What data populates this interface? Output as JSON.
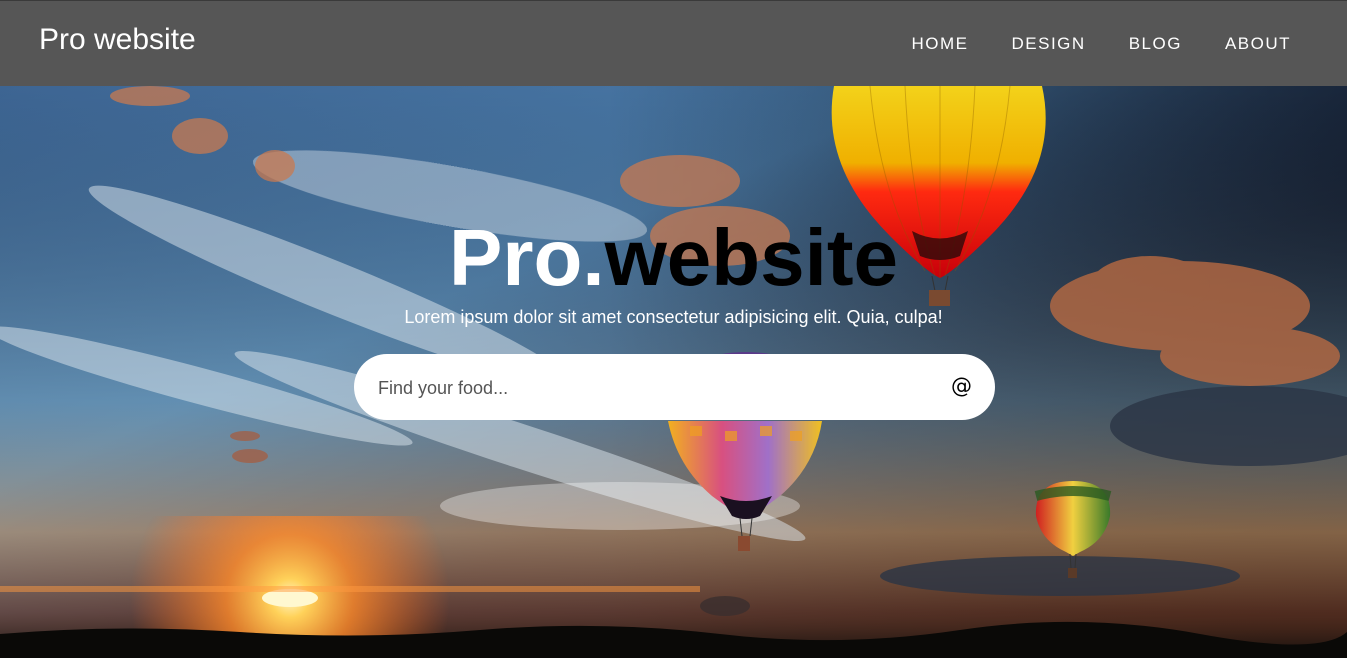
{
  "header": {
    "logo": "Pro website",
    "nav": [
      "HOME",
      "DESIGN",
      "BLOG",
      "ABOUT"
    ]
  },
  "hero": {
    "title_part1": "Pro.",
    "title_part2": "website",
    "subtitle": "Lorem ipsum dolor sit amet consectetur adipisicing elit. Quia, culpa!",
    "background": "sunset-sky-with-hot-air-balloons"
  },
  "search": {
    "placeholder": "Find your food...",
    "value": "",
    "icon": "at-icon",
    "icon_glyph": "@"
  },
  "colors": {
    "header_bg": "#565656",
    "text_light": "#ffffff",
    "title_dark": "#000000",
    "search_bg": "#ffffff"
  }
}
